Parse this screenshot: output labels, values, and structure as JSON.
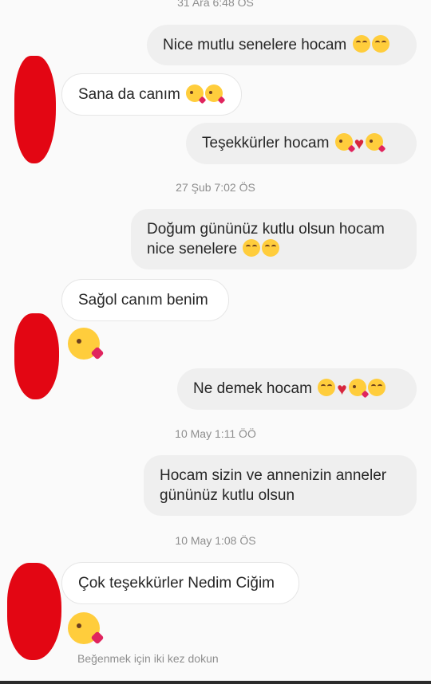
{
  "timestamps": [
    "31 Ara 6:48 ÖS",
    "27 Şub 7:02 ÖS",
    "10 May 1:11 ÖÖ",
    "10 May 1:08 ÖS"
  ],
  "messages": [
    {
      "text": "Nice mutlu senelere hocam"
    },
    {
      "text": "Sana da canım"
    },
    {
      "text": "Teşekkürler hocam"
    },
    {
      "line1": "Doğum gününüz kutlu olsun hocam",
      "line2": "nice senelere"
    },
    {
      "text": "Sağol canım benim"
    },
    {
      "text": "Ne demek hocam"
    },
    {
      "line1": "Hocam sizin ve annenizin anneler",
      "line2": "gününüz kutlu olsun"
    },
    {
      "text": "Çok teşekkürler Nedim Ciğim"
    }
  ],
  "hint": "Beğenmek için iki kez dokun",
  "colors": {
    "outgoing_bubble": "#efefef",
    "incoming_bubble": "#ffffff",
    "redaction": "#e30613"
  },
  "icons": [
    "smiling-face-icon",
    "kissing-face-icon",
    "red-heart-icon"
  ]
}
